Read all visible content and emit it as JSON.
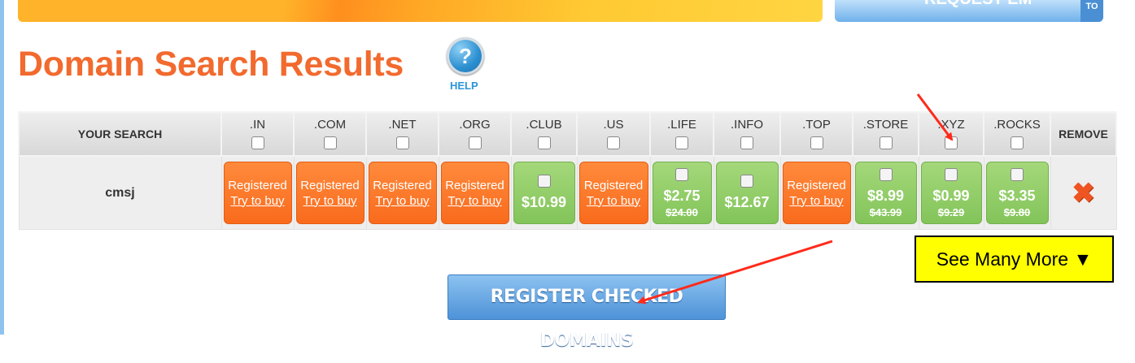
{
  "top_request": {
    "text": "REQUEST EM",
    "tab": "TO"
  },
  "page": {
    "title": "Domain Search Results",
    "help_label": "HELP",
    "help_glyph": "?"
  },
  "table": {
    "your_search_header": "YOUR SEARCH",
    "remove_header": "REMOVE",
    "tlds": [
      ".IN",
      ".COM",
      ".NET",
      ".ORG",
      ".CLUB",
      ".US",
      ".LIFE",
      ".INFO",
      ".TOP",
      ".STORE",
      ".XYZ",
      ".ROCKS"
    ],
    "search_name": "cmsj",
    "results": [
      {
        "status": "Registered",
        "action": "Try to buy"
      },
      {
        "status": "Registered",
        "action": "Try to buy"
      },
      {
        "status": "Registered",
        "action": "Try to buy"
      },
      {
        "status": "Registered",
        "action": "Try to buy"
      },
      {
        "price": "$10.99",
        "old_price": ""
      },
      {
        "status": "Registered",
        "action": "Try to buy"
      },
      {
        "price": "$2.75",
        "old_price": "$24.00"
      },
      {
        "price": "$12.67",
        "old_price": ""
      },
      {
        "status": "Registered",
        "action": "Try to buy"
      },
      {
        "price": "$8.99",
        "old_price": "$43.99"
      },
      {
        "price": "$0.99",
        "old_price": "$9.29"
      },
      {
        "price": "$3.35",
        "old_price": "$9.80"
      }
    ],
    "remove_icon": "close-x-icon"
  },
  "see_more": "See Many More ▼",
  "register_button": "REGISTER CHECKED DOMAINS",
  "colors": {
    "title": "#f26a2e",
    "registered": "#f96b1d",
    "available": "#83c45a",
    "see_more_bg": "#ffff00",
    "register_btn": "#4e92d8",
    "annotation_arrow": "#ff2a1a"
  }
}
